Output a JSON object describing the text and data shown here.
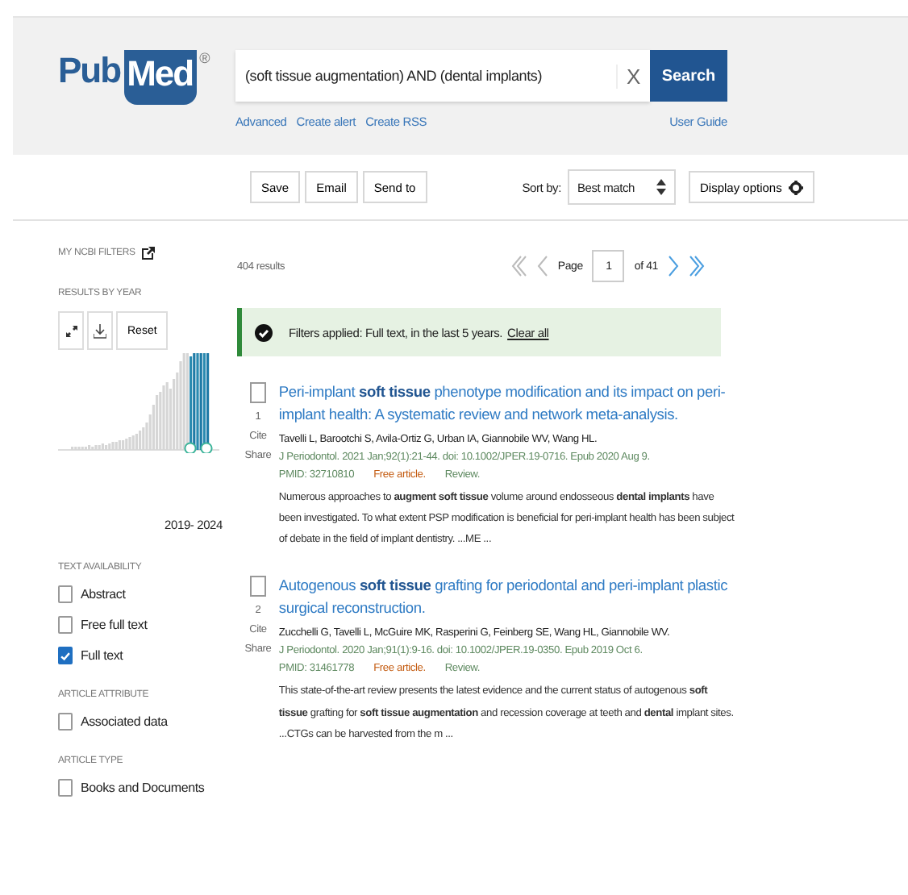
{
  "logo": {
    "left": "Pub",
    "right": "Med",
    "mark": "®"
  },
  "search": {
    "value": "(soft tissue augmentation) AND (dental implants)",
    "clear": "X",
    "button": "Search",
    "links": [
      "Advanced",
      "Create alert",
      "Create RSS"
    ],
    "guide": "User Guide"
  },
  "toolbar": {
    "buttons": [
      "Save",
      "Email",
      "Send to"
    ],
    "sort_label": "Sort by:",
    "sort_value": "Best match",
    "display": "Display options"
  },
  "sidebar": {
    "ncbi": "MY NCBI FILTERS",
    "year_heading": "RESULTS BY YEAR",
    "reset": "Reset",
    "range": "2019- 2024",
    "groups": [
      {
        "heading": "TEXT AVAILABILITY",
        "items": [
          {
            "label": "Abstract",
            "checked": false
          },
          {
            "label": "Free full text",
            "checked": false
          },
          {
            "label": "Full text",
            "checked": true
          }
        ]
      },
      {
        "heading": "ARTICLE ATTRIBUTE",
        "items": [
          {
            "label": "Associated data",
            "checked": false
          }
        ]
      },
      {
        "heading": "ARTICLE TYPE",
        "items": [
          {
            "label": "Books and Documents",
            "checked": false
          }
        ]
      }
    ]
  },
  "results": {
    "count": "404 results",
    "page_label": "Page",
    "page": "1",
    "of": "of 41"
  },
  "filter_banner": {
    "text": "Filters applied: Full text, in the last 5 years.",
    "link": "Clear all"
  },
  "articles": [
    {
      "number": "1",
      "title": "Peri-implant **soft tissue** phenotype modification and its impact on peri-implant health: A systematic review and network meta-analysis.",
      "authors": "Tavelli L, Barootchi S, Avila-Ortiz G, Urban IA, Giannobile WV, Wang HL.",
      "citation": "J Periodontol. 2021 Jan;92(1):21-44. doi: 10.1002/JPER.19-0716. Epub 2020 Aug 9.",
      "pmid": "PMID: 32710810",
      "free": "Free article.",
      "type": "Review.",
      "actions": [
        "Cite",
        "Share"
      ],
      "snippet": "Numerous approaches to **augment soft tissue** volume around endosseous **dental implants** have been investigated. To what extent PSP modification is beneficial for peri-implant health has been subject of debate in the field of implant dentistry. ...ME ...",
      "checked": false
    },
    {
      "number": "2",
      "title": "Autogenous **soft tissue** grafting for periodontal and peri-implant plastic surgical reconstruction.",
      "authors": "Zucchelli G, Tavelli L, McGuire MK, Rasperini G, Feinberg SE, Wang HL, Giannobile WV.",
      "citation": "J Periodontol. 2020 Jan;91(1):9-16. doi: 10.1002/JPER.19-0350. Epub 2019 Oct 6.",
      "pmid": "PMID: 31461778",
      "free": "Free article.",
      "type": "Review.",
      "actions": [
        "Cite",
        "Share"
      ],
      "snippet": "This state-of-the-art review presents the latest evidence and the current status of autogenous **soft tissue** grafting for **soft tissue augmentation** and recession coverage at teeth and **dental** implant sites. ...CTGs can be harvested from the m ...",
      "checked": false
    }
  ]
}
